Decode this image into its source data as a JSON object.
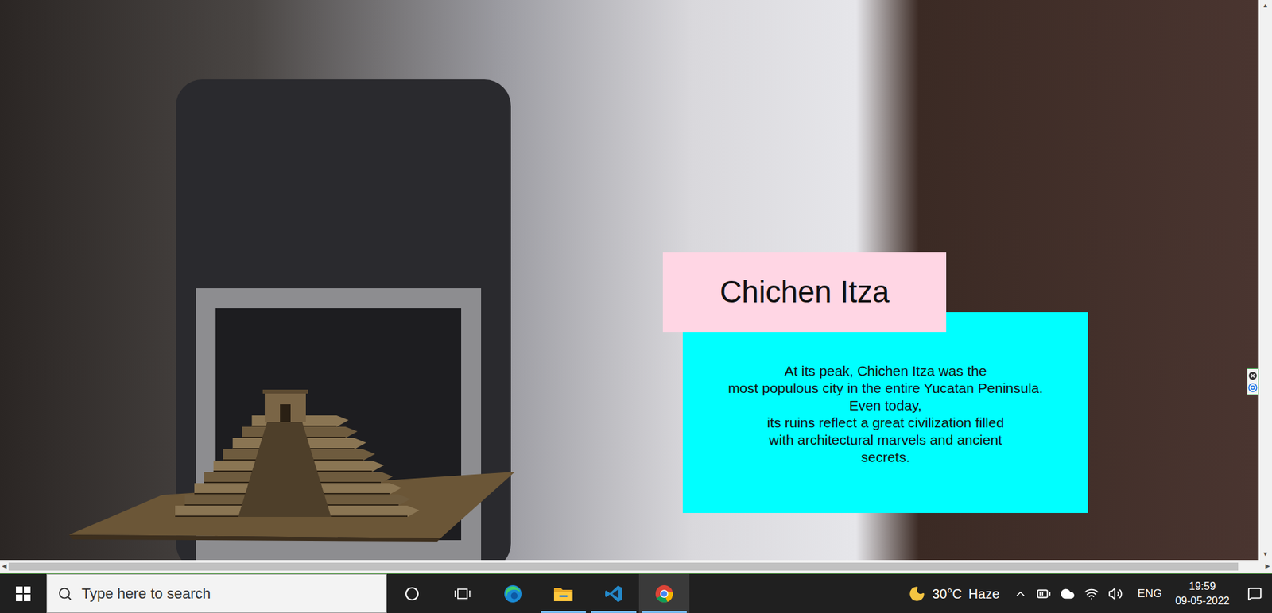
{
  "ar_scene": {
    "title": "Chichen Itza",
    "description": [
      "At its peak, Chichen Itza was the",
      "most populous city in the entire Yucatan Peninsula.",
      "Even today,",
      "its ruins reflect a great civilization filled",
      "with architectural marvels and ancient",
      "secrets."
    ]
  },
  "scrollbars": {
    "vertical": {
      "up": "▲",
      "down": "▼"
    },
    "horizontal": {
      "left": "◀",
      "right": "▶",
      "level": 0.98
    }
  },
  "taskbar": {
    "search": {
      "placeholder": "Type here to search"
    },
    "buttons": [
      {
        "kind": "cortana",
        "running": false,
        "selected": false
      },
      {
        "kind": "task-view",
        "running": false,
        "selected": false
      },
      {
        "kind": "edge",
        "running": false,
        "selected": false
      },
      {
        "kind": "explorer",
        "running": true,
        "selected": false
      },
      {
        "kind": "vscode",
        "running": true,
        "selected": false
      },
      {
        "kind": "chrome",
        "running": true,
        "selected": true
      }
    ],
    "tray": {
      "temperature": "30°C",
      "condition": "Haze",
      "language": "ENG",
      "time": "19:59",
      "date": "09-05-2022"
    }
  }
}
